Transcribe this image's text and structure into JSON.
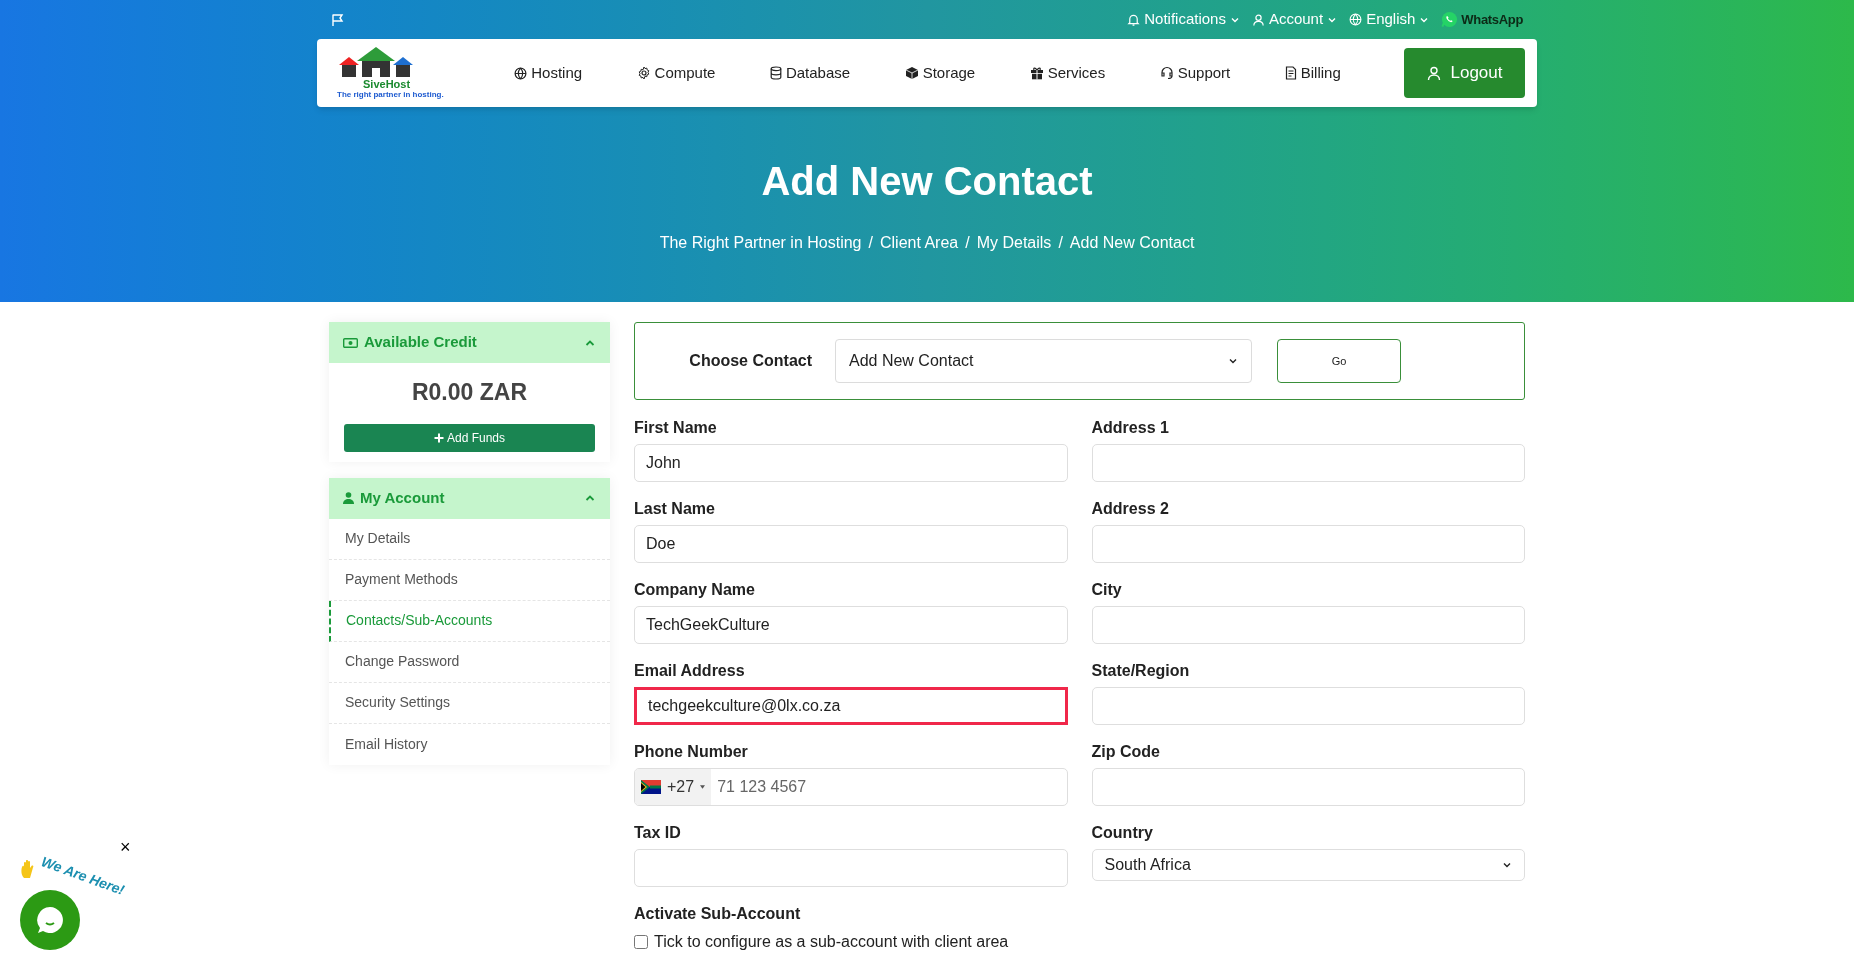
{
  "top_bar": {
    "items": [
      {
        "label": "Notifications"
      },
      {
        "label": "Account"
      },
      {
        "label": "English"
      }
    ],
    "whatsapp": "WhatsApp"
  },
  "nav": {
    "logo": {
      "name": "SiveHost",
      "tagline": "The right partner in hosting."
    },
    "items": [
      {
        "label": "Hosting"
      },
      {
        "label": "Compute"
      },
      {
        "label": "Database"
      },
      {
        "label": "Storage"
      },
      {
        "label": "Services"
      },
      {
        "label": "Support"
      },
      {
        "label": "Billing"
      }
    ],
    "logout": "Logout"
  },
  "hero": {
    "title": "Add New Contact",
    "breadcrumb": [
      "The Right Partner in Hosting",
      "Client Area",
      "My Details",
      "Add New Contact"
    ],
    "separator": "/"
  },
  "sidebar": {
    "credit": {
      "title": "Available Credit",
      "expanded": true,
      "amount": "R0.00 ZAR",
      "button": "Add Funds"
    },
    "account": {
      "title": "My Account",
      "expanded": true,
      "items": [
        {
          "label": "My Details",
          "selected": false
        },
        {
          "label": "Payment Methods",
          "selected": false
        },
        {
          "label": "Contacts/Sub-Accounts",
          "selected": true
        },
        {
          "label": "Change Password",
          "selected": false
        },
        {
          "label": "Security Settings",
          "selected": false
        },
        {
          "label": "Email History",
          "selected": false
        }
      ]
    }
  },
  "choose_contact": {
    "label": "Choose Contact",
    "value": "Add New Contact",
    "button": "Go"
  },
  "fields_left": [
    {
      "kind": "text",
      "label": "First Name",
      "value": "John",
      "highlighted": false
    },
    {
      "kind": "text",
      "label": "Last Name",
      "value": "Doe",
      "highlighted": false
    },
    {
      "kind": "text",
      "label": "Company Name",
      "value": "TechGeekCulture",
      "highlighted": false
    },
    {
      "kind": "text",
      "label": "Email Address",
      "value": "techgeekculture@0lx.co.za",
      "highlighted": true
    },
    {
      "kind": "phone",
      "label": "Phone Number",
      "code": "+27",
      "placeholder": "71 123 4567",
      "highlighted": false
    },
    {
      "kind": "text",
      "label": "Tax ID",
      "highlighted": false
    }
  ],
  "fields_right": [
    {
      "kind": "text",
      "label": "Address 1",
      "highlighted": false
    },
    {
      "kind": "text",
      "label": "Address 2",
      "highlighted": false
    },
    {
      "kind": "text",
      "label": "City",
      "highlighted": false
    },
    {
      "kind": "text",
      "label": "State/Region",
      "highlighted": false
    },
    {
      "kind": "text",
      "label": "Zip Code",
      "highlighted": false
    },
    {
      "kind": "select",
      "label": "Country",
      "value": "South Africa",
      "highlighted": false
    }
  ],
  "activate": {
    "title": "Activate Sub-Account",
    "checkbox": {
      "label": "Tick to configure as a sub-account with client area",
      "checked": false
    }
  },
  "chat_widget": {
    "caption": "We Are Here!",
    "close": "×"
  }
}
